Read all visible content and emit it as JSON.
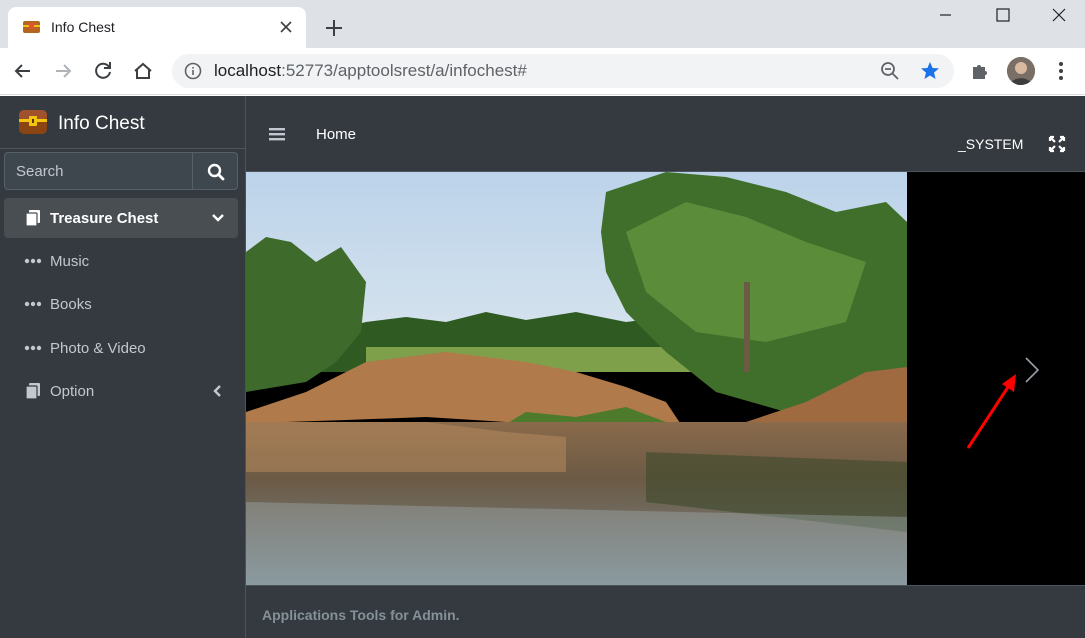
{
  "browser": {
    "tab_title": "Info Chest",
    "url_host": "localhost",
    "url_rest": ":52773/apptoolsrest/a/infochest#",
    "icons": [
      "favicon-chest-icon",
      "close-icon",
      "plus-icon",
      "back-icon",
      "forward-icon",
      "reload-icon",
      "home-icon",
      "info-icon",
      "zoom-icon",
      "star-icon",
      "extensions-icon",
      "menu-icon"
    ],
    "accent": "#1a73e8"
  },
  "sidebar": {
    "brand": "Info Chest",
    "search_placeholder": "Search",
    "items": [
      {
        "label": "Treasure Chest",
        "icon": "copy-icon",
        "active": true,
        "caret": "chevron-down-icon"
      },
      {
        "label": "Music",
        "icon": "ellipsis-icon"
      },
      {
        "label": "Books",
        "icon": "ellipsis-icon"
      },
      {
        "label": "Photo & Video",
        "icon": "ellipsis-icon"
      },
      {
        "label": "Option",
        "icon": "copy-icon",
        "caret": "chevron-left-icon"
      }
    ],
    "bg_color": "#343a40",
    "active_color": "#494e53"
  },
  "topnav": {
    "home": "Home",
    "user": "_SYSTEM"
  },
  "content": {
    "image": "river-landscape-photo",
    "nav_next": "chevron-right-icon",
    "annotation_color": "#ff0000"
  },
  "footer": {
    "text": "Applications Tools for Admin."
  }
}
